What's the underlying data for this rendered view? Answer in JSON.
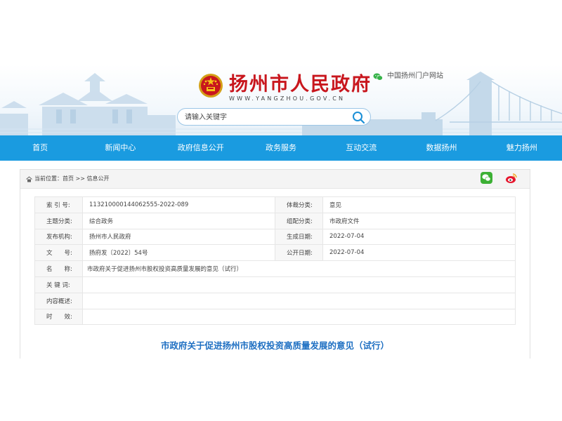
{
  "header": {
    "site_title": "扬州市人民政府",
    "site_url": "WWW.YANGZHOU.GOV.CN",
    "portal_link": "中国扬州门户网站",
    "search_placeholder": "请输入关键字"
  },
  "nav": {
    "items": [
      "首页",
      "新闻中心",
      "政府信息公开",
      "政务服务",
      "互动交流",
      "数据扬州",
      "魅力扬州"
    ]
  },
  "breadcrumb": "当前位置：首页 >> 信息公开",
  "meta": {
    "rows": [
      {
        "label": "索 引 号:",
        "value": "113210000144062555-2022-089",
        "label2": "体裁分类:",
        "value2": "意见"
      },
      {
        "label": "主题分类:",
        "value": "综合政务",
        "label2": "组配分类:",
        "value2": "市政府文件"
      },
      {
        "label": "发布机构:",
        "value": "扬州市人民政府",
        "label2": "生成日期:",
        "value2": "2022-07-04"
      },
      {
        "label": "文　　号:",
        "value": "扬府发〔2022〕54号",
        "label2": "公开日期:",
        "value2": "2022-07-04"
      }
    ],
    "name_label": "名　　称:",
    "name_value": "市政府关于促进扬州市股权投资高质量发展的意见（试行）",
    "keywords_label": "关 键 词:",
    "keywords_value": "",
    "summary_label": "内容概述:",
    "summary_value": "",
    "validity_label": "时　　效:",
    "validity_value": ""
  },
  "document": {
    "title": "市政府关于促进扬州市股权投资高质量发展的意见（试行）"
  },
  "colors": {
    "nav_bg": "#1a9be0",
    "title_red": "#c8161d",
    "doc_title_blue": "#1e6fc2"
  }
}
